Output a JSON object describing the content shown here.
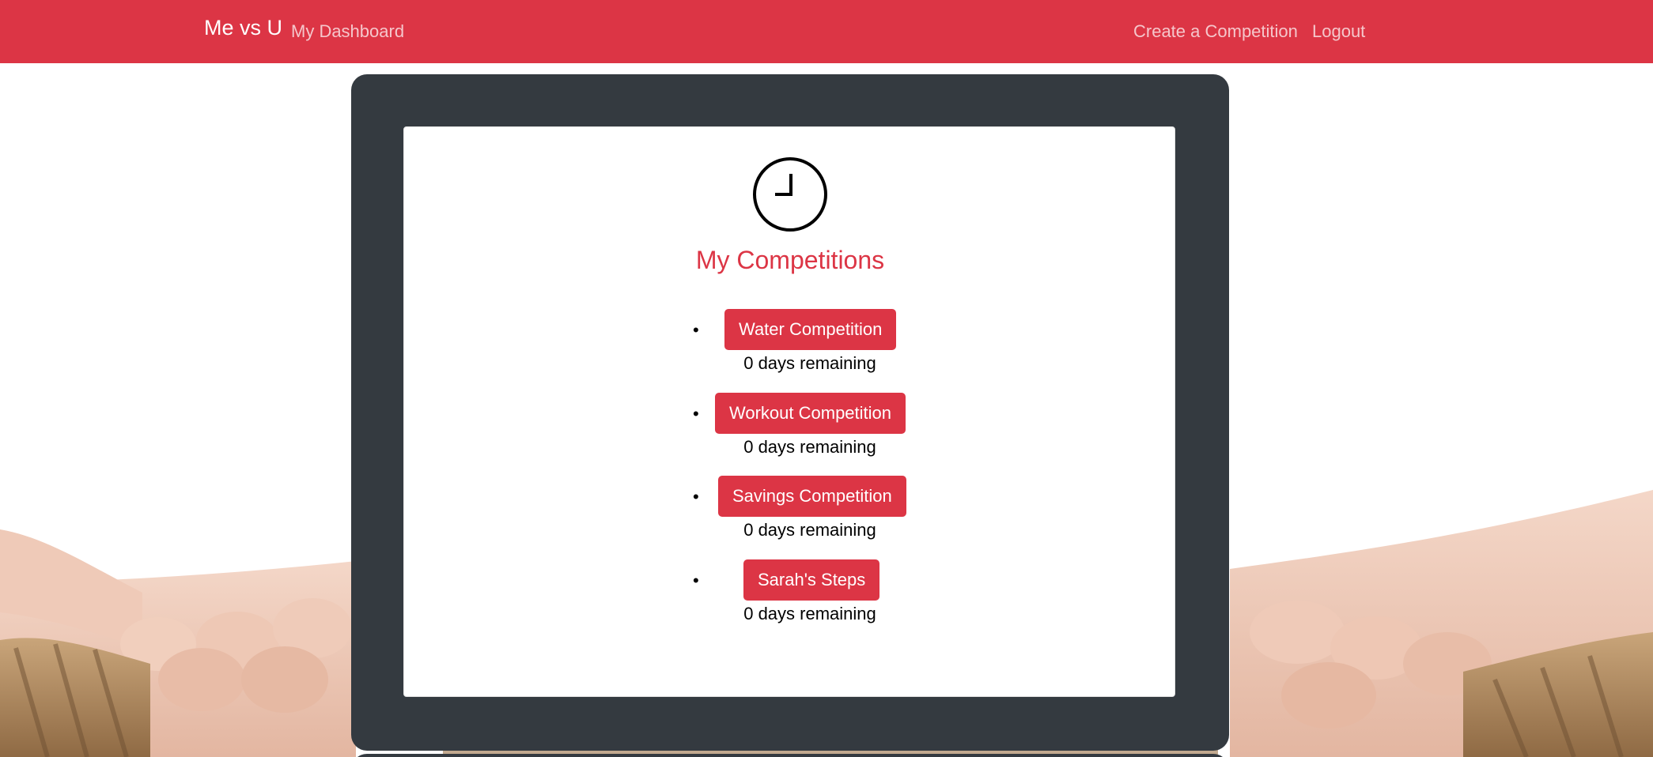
{
  "navbar": {
    "brand": "Me vs U",
    "dashboard_link": "My Dashboard",
    "create_link": "Create a Competition",
    "logout_link": "Logout"
  },
  "main": {
    "title": "My Competitions",
    "competitions": [
      {
        "name": "Water Competition",
        "remaining": "0 days remaining"
      },
      {
        "name": "Workout Competition",
        "remaining": "0 days remaining"
      },
      {
        "name": "Savings Competition",
        "remaining": "0 days remaining"
      },
      {
        "name": "Sarah's Steps",
        "remaining": "0 days remaining"
      }
    ]
  },
  "icons": {
    "clock": "clock-icon"
  },
  "colors": {
    "brand_red": "#dc3545",
    "card_dark": "#343a40",
    "panel_white": "#ffffff"
  }
}
